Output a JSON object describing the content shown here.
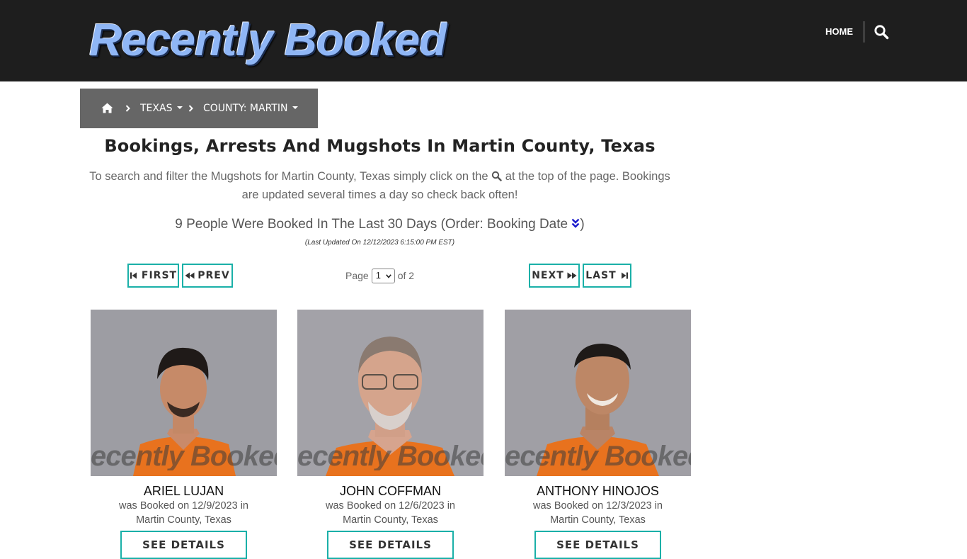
{
  "header": {
    "logo_text": "Recently Booked",
    "nav_home": "HOME",
    "search_icon": "search-icon"
  },
  "breadcrumb": {
    "home_icon": "home-icon",
    "state": "TEXAS",
    "county": "COUNTY: MARTIN"
  },
  "main": {
    "title": "Bookings, Arrests And Mugshots In Martin County, Texas",
    "intro_before": "To search and filter the Mugshots for Martin County, Texas simply click on the",
    "intro_after": "at the top of the page. Bookings are updated several times a day so check back often!",
    "booked_count": "9 People Were Booked In The Last 30 Days (Order: Booking Date",
    "booked_close": ")",
    "last_updated": "(Last Updated On 12/12/2023 6:15:00 PM EST)"
  },
  "pagination": {
    "first": "FIRST",
    "prev": "PREV",
    "next": "NEXT",
    "last": "LAST",
    "page_label": "Page",
    "current_page": "1",
    "of_label": "of 2"
  },
  "cards": [
    {
      "name": "ARIEL LUJAN",
      "booked": "was Booked on 12/9/2023 in",
      "location": "Martin County, Texas",
      "button": "SEE DETAILS",
      "watermark": "ecently Booked.co"
    },
    {
      "name": "JOHN COFFMAN",
      "booked": "was Booked on 12/6/2023 in",
      "location": "Martin County, Texas",
      "button": "SEE DETAILS",
      "watermark": "ecently Booked.co"
    },
    {
      "name": "ANTHONY HINOJOS",
      "booked": "was Booked on 12/3/2023 in",
      "location": "Martin County, Texas",
      "button": "SEE DETAILS",
      "watermark": "ecently Booked.co"
    }
  ],
  "colors": {
    "header_bg": "#1e1e1e",
    "breadcrumb_bg": "#666666",
    "accent_teal": "#1ab0a8",
    "order_arrow": "#1a1acc"
  }
}
